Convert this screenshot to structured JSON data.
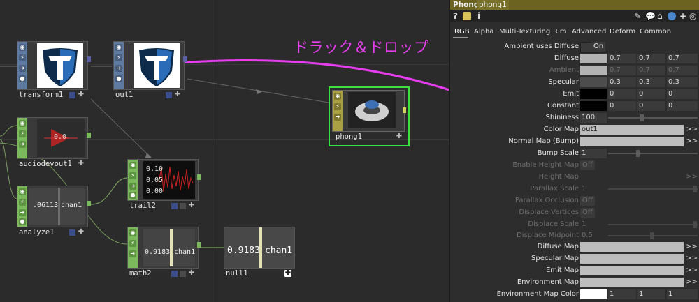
{
  "annotation": "ドラック＆ドロップ",
  "nodes": {
    "transform1": {
      "label": "transform1"
    },
    "out1": {
      "label": "out1"
    },
    "phong1": {
      "label": "phong1"
    },
    "audiodevout1": {
      "label": "audiodevout1",
      "view_text": "0.0"
    },
    "trail2": {
      "label": "trail2",
      "values": [
        "0.10",
        "0.05",
        "0.00"
      ]
    },
    "analyze1": {
      "label": "analyze1",
      "value": ".06113",
      "channel": "chan1"
    },
    "math2": {
      "label": "math2",
      "value": "0.9183",
      "channel": "chan1"
    },
    "null1": {
      "label": "null1",
      "value": "0.9183",
      "channel": "chan1"
    }
  },
  "panel": {
    "op_type": "Phong",
    "op_name": "phong1",
    "tools": {
      "help": "?",
      "info": "i"
    },
    "tabs": [
      "RGB",
      "Alpha",
      "Multi-Texturing",
      "Rim",
      "Advanced",
      "Deform",
      "Common"
    ],
    "active_tab": "RGB",
    "params": {
      "ambient_uses_diffuse": {
        "label": "Ambient uses Diffuse",
        "value": "On"
      },
      "diffuse": {
        "label": "Diffuse",
        "values": [
          "0.7",
          "0.7",
          "0.7"
        ]
      },
      "ambient": {
        "label": "Ambient",
        "values": [
          "0.7",
          "0.7",
          "0.7"
        ]
      },
      "specular": {
        "label": "Specular",
        "values": [
          "0.3",
          "0.3",
          "0.3"
        ]
      },
      "emit": {
        "label": "Emit",
        "values": [
          "0",
          "0",
          "0"
        ]
      },
      "constant": {
        "label": "Constant",
        "values": [
          "0",
          "0",
          "0"
        ]
      },
      "shininess": {
        "label": "Shininess",
        "value": "100"
      },
      "color_map": {
        "label": "Color Map",
        "value": "out1"
      },
      "normal_map": {
        "label": "Normal Map (Bump)",
        "value": ""
      },
      "bump_scale": {
        "label": "Bump Scale",
        "value": "1"
      },
      "enable_height_map": {
        "label": "Enable Height Map",
        "value": "Off"
      },
      "height_map": {
        "label": "Height Map",
        "value": ""
      },
      "parallax_scale": {
        "label": "Parallax Scale",
        "value": "1"
      },
      "parallax_occlusion": {
        "label": "Parallax Occlusion",
        "value": "Off"
      },
      "displace_vertices": {
        "label": "Displace Vertices",
        "value": "Off"
      },
      "displace_scale": {
        "label": "Displace Scale",
        "value": "1"
      },
      "displace_midpoint": {
        "label": "Displace Midpoint",
        "value": "0.5"
      },
      "diffuse_map": {
        "label": "Diffuse Map",
        "value": ""
      },
      "specular_map": {
        "label": "Specular Map",
        "value": ""
      },
      "emit_map": {
        "label": "Emit Map",
        "value": ""
      },
      "environment_map": {
        "label": "Environment Map",
        "value": ""
      },
      "environment_map_color": {
        "label": "Environment Map Color",
        "values": [
          "1",
          "1",
          "1"
        ]
      }
    },
    "arrows": ">>"
  },
  "colors": {
    "annotation": "#e83cf0",
    "top_header": "#6c6321",
    "chop_strip": "#7cb85c",
    "top_strip": "#5f7aa0",
    "mat_strip": "#a8a042",
    "selection": "#3ee23e"
  }
}
